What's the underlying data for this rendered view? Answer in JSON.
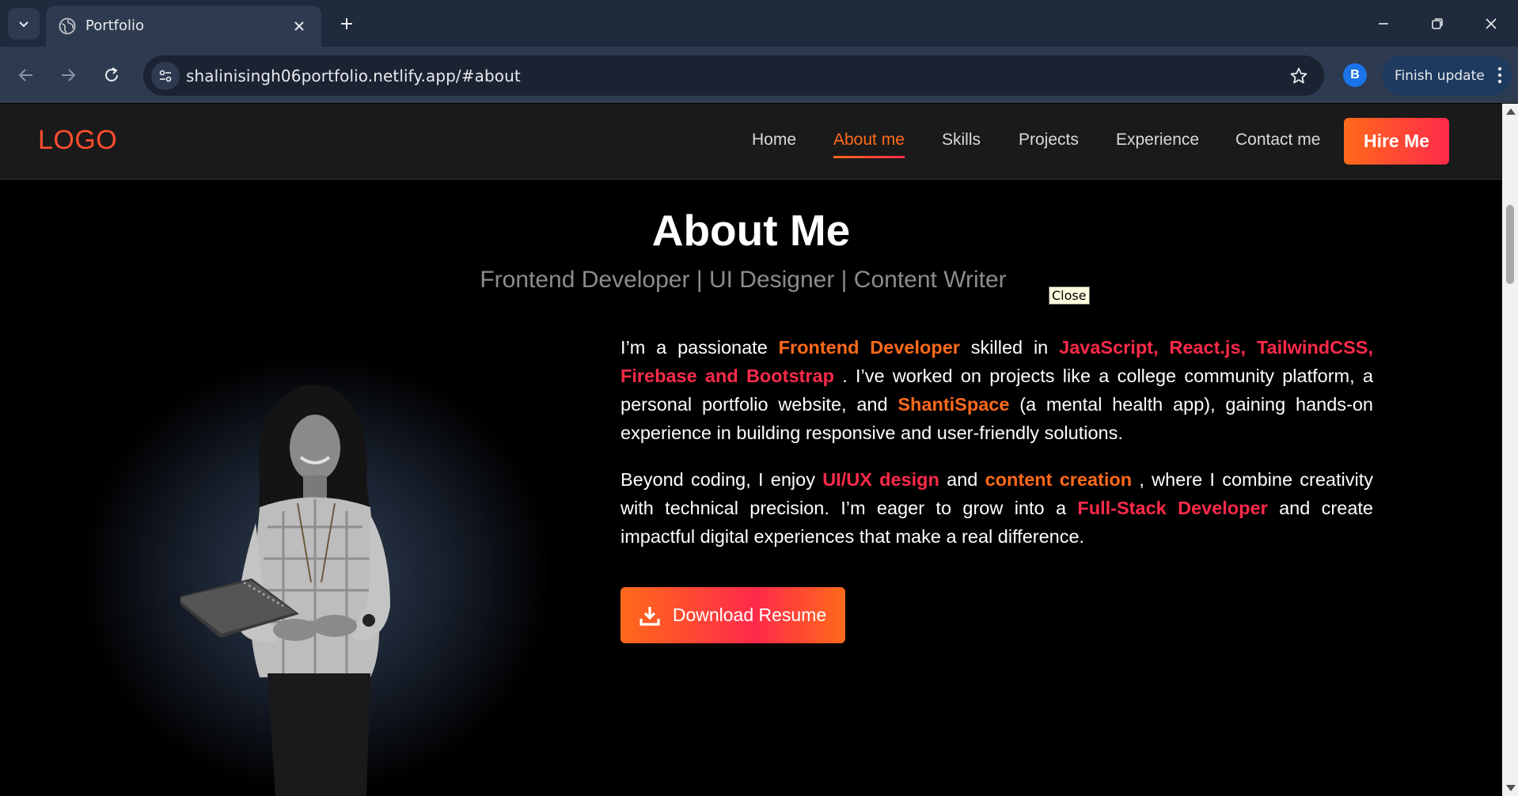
{
  "browser": {
    "tab_title": "Portfolio",
    "url": "shalinisingh06portfolio.netlify.app/#about",
    "profile_initial": "B",
    "finish_update_label": "Finish update"
  },
  "site": {
    "logo": "LOGO",
    "nav": [
      {
        "label": "Home",
        "active": false
      },
      {
        "label": "About me",
        "active": true
      },
      {
        "label": "Skills",
        "active": false
      },
      {
        "label": "Projects",
        "active": false
      },
      {
        "label": "Experience",
        "active": false
      },
      {
        "label": "Contact me",
        "active": false
      }
    ],
    "hire_label": "Hire Me"
  },
  "about": {
    "title": "About Me",
    "subtitle": "Frontend Developer | UI Designer | Content Writer",
    "tooltip": "Close",
    "p1": {
      "t1": "I’m a passionate ",
      "h1": "Frontend Developer",
      "t2": " skilled in ",
      "h2": "JavaScript, React.js, TailwindCSS, Firebase and Bootstrap",
      "t3": " . I’ve worked on projects like a college community platform, a personal portfolio website, and ",
      "h3": "ShantiSpace",
      "t4": " (a mental health app), gaining hands-on experience in building responsive and user-friendly solutions."
    },
    "p2": {
      "t1": "Beyond coding, I enjoy ",
      "h1": "UI/UX design",
      "t2": " and ",
      "h2": "content creation",
      "t3": " , where I combine creativity with technical precision. I’m eager to grow into a ",
      "h3": "Full-Stack Developer",
      "t4": " and create impactful digital experiences that make a real difference."
    },
    "download_label": "Download Resume"
  },
  "colors": {
    "accent_orange": "#ff6a1a",
    "accent_red": "#ff2a4a",
    "logo": "#ff4d2e"
  }
}
